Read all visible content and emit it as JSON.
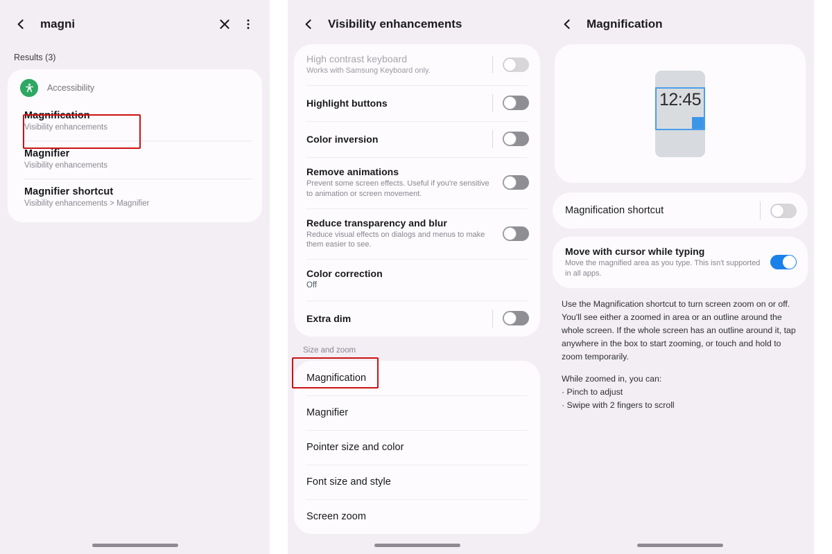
{
  "panels": {
    "search": {
      "statusbar": {
        "left": "",
        "right": ""
      },
      "appbar": {
        "back_icon": "chevron-left-icon",
        "query": "magni",
        "clear_icon": "close-icon",
        "more_icon": "more-vertical-icon"
      },
      "results_label": "Results (3)",
      "category": {
        "icon": "accessibility-icon",
        "icon_color": "#2ea862",
        "label": "Accessibility"
      },
      "results": [
        {
          "title": "Magnification",
          "subtitle": "Visibility enhancements",
          "highlighted": true
        },
        {
          "title": "Magnifier",
          "subtitle": "Visibility enhancements",
          "highlighted": false
        },
        {
          "title": "Magnifier shortcut",
          "subtitle": "Visibility enhancements > Magnifier",
          "highlighted": false
        }
      ]
    },
    "visibility": {
      "appbar": {
        "back_icon": "chevron-left-icon",
        "title": "Visibility enhancements"
      },
      "group_one": [
        {
          "label": "High contrast keyboard",
          "sub": "Works with Samsung Keyboard only.",
          "control": "toggle",
          "state": "off",
          "disabled": true,
          "divider": true
        },
        {
          "label": "Highlight buttons",
          "sub": "",
          "control": "toggle",
          "state": "off",
          "disabled": false,
          "divider": true
        },
        {
          "label": "Color inversion",
          "sub": "",
          "control": "toggle",
          "state": "off",
          "disabled": false,
          "divider": true
        },
        {
          "label": "Remove animations",
          "sub": "Prevent some screen effects. Useful if you're sensitive to animation or screen movement.",
          "control": "toggle",
          "state": "off",
          "disabled": false,
          "divider": false
        },
        {
          "label": "Reduce transparency and blur",
          "sub": "Reduce visual effects on dialogs and menus to make them easier to see.",
          "control": "toggle",
          "state": "off",
          "disabled": false,
          "divider": false
        },
        {
          "label": "Color correction",
          "sub": "Off",
          "control": "none",
          "disabled": false,
          "divider": false
        },
        {
          "label": "Extra dim",
          "sub": "",
          "control": "toggle",
          "state": "off",
          "disabled": false,
          "divider": true
        }
      ],
      "section_header": "Size and zoom",
      "group_two": [
        {
          "label": "Magnification",
          "highlighted": true
        },
        {
          "label": "Magnifier",
          "highlighted": false
        },
        {
          "label": "Pointer size and color",
          "highlighted": false
        },
        {
          "label": "Font size and style",
          "highlighted": false
        },
        {
          "label": "Screen zoom",
          "highlighted": false
        }
      ]
    },
    "magnification": {
      "appbar": {
        "back_icon": "chevron-left-icon",
        "title": "Magnification"
      },
      "preview": {
        "clock": "12:45",
        "box_color": "#4a9eea",
        "phone_color": "#d7dade"
      },
      "shortcut_row": {
        "label": "Magnification shortcut",
        "control": "toggle",
        "state": "off"
      },
      "cursor_row": {
        "label": "Move with cursor while typing",
        "sub": "Move the magnified area as you type. This isn't supported in all apps.",
        "control": "toggle",
        "state": "on"
      },
      "description": {
        "paragraph1": "Use the Magnification shortcut to turn screen zoom on or off. You'll see either a zoomed in area or an outline around the whole screen. If the whole screen has an outline around it, tap anywhere in the box to start zooming, or touch and hold to zoom temporarily.",
        "paragraph2_head": "While zoomed in, you can:",
        "bullet1": "· Pinch to adjust",
        "bullet2": "· Swipe with 2 fingers to scroll"
      }
    }
  },
  "colors": {
    "background": "#f3eef4",
    "card": "#fdfbfd",
    "accent_blue": "#1a80ea",
    "annotation_red": "#cc1111",
    "accessibility_green": "#2ea862"
  }
}
